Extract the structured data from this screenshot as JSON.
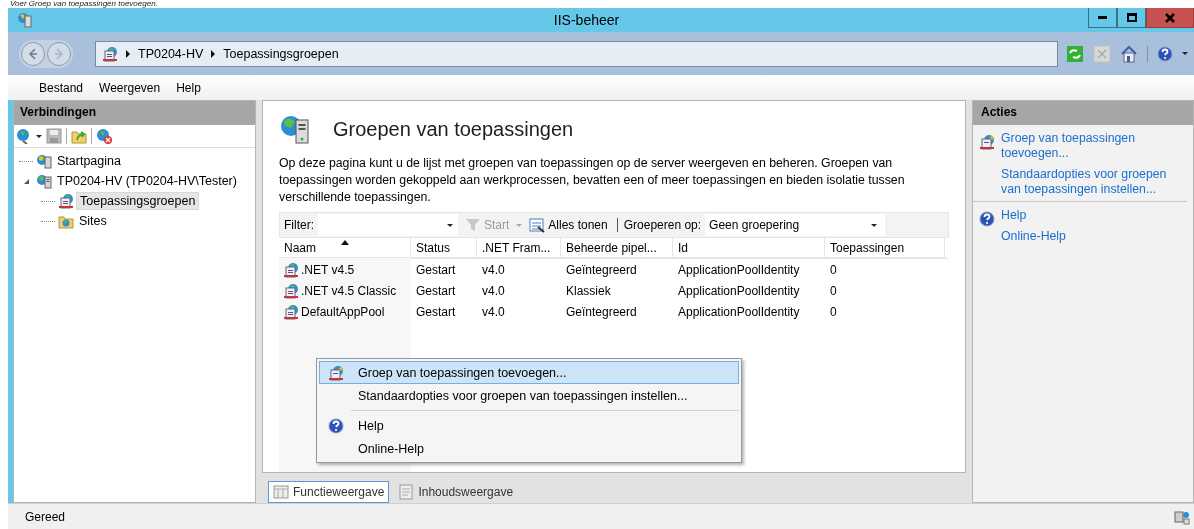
{
  "caption": "Voer Groep van toepassingen toevoegen.",
  "window": {
    "title": "IIS-beheer"
  },
  "address": {
    "crumbs": [
      "TP0204-HV",
      "Toepassingsgroepen"
    ]
  },
  "menu": [
    "Bestand",
    "Weergeven",
    "Help"
  ],
  "connections": {
    "title": "Verbindingen",
    "tree": [
      {
        "label": "Startpagina",
        "kind": "start",
        "selected": false
      },
      {
        "label": "TP0204-HV (TP0204-HV\\Tester)",
        "kind": "server",
        "selected": false,
        "expanded": true,
        "children": [
          {
            "label": "Toepassingsgroepen",
            "kind": "pools",
            "selected": true
          },
          {
            "label": "Sites",
            "kind": "sites",
            "selected": false
          }
        ]
      }
    ]
  },
  "page": {
    "title": "Groepen van toepassingen",
    "description": "Op deze pagina kunt u de lijst met groepen van toepassingen op de server weergeven en beheren. Groepen van toepassingen worden gekoppeld aan werkprocessen, bevatten een of meer toepassingen en bieden isolatie tussen verschillende toepassingen.",
    "filter_label": "Filter:",
    "start": {
      "label": "Start",
      "disabled": true
    },
    "show_all": "Alles tonen",
    "group_label": "Groeperen op:",
    "group_value": "Geen groepering"
  },
  "table": {
    "columns": [
      {
        "label": "Naam",
        "sorted": true
      },
      {
        "label": "Status",
        "sorted": false
      },
      {
        "label": ".NET Fram...",
        "sorted": false
      },
      {
        "label": "Beheerde pipel...",
        "sorted": false
      },
      {
        "label": "Id",
        "sorted": false
      },
      {
        "label": "Toepassingen",
        "sorted": false
      }
    ],
    "rows": [
      [
        ".NET v4.5",
        "Gestart",
        "v4.0",
        "Geïntegreerd",
        "ApplicationPoolIdentity",
        "0"
      ],
      [
        ".NET v4.5 Classic",
        "Gestart",
        "v4.0",
        "Klassiek",
        "ApplicationPoolIdentity",
        "0"
      ],
      [
        "DefaultAppPool",
        "Gestart",
        "v4.0",
        "Geïntegreerd",
        "ApplicationPoolIdentity",
        "0"
      ]
    ]
  },
  "view_tabs": [
    {
      "label": "Functieweergave",
      "selected": true
    },
    {
      "label": "Inhoudsweergave",
      "selected": false
    }
  ],
  "actions": {
    "title": "Acties",
    "groups": [
      {
        "kind": "add",
        "links": [
          "Groep van toepassingen toevoegen...",
          "Standaardopties voor groepen van toepassingen instellen..."
        ]
      },
      {
        "kind": "help",
        "links": [
          "Help",
          "Online-Help"
        ]
      }
    ]
  },
  "context_menu": [
    {
      "kind": "add",
      "label": "Groep van toepassingen toevoegen...",
      "selected": true
    },
    {
      "kind": "plain",
      "label": "Standaardopties voor groepen van toepassingen instellen...",
      "selected": false
    },
    {
      "kind": "separator"
    },
    {
      "kind": "help",
      "label": "Help",
      "selected": false
    },
    {
      "kind": "plain",
      "label": "Online-Help",
      "selected": false
    }
  ],
  "status": "Gereed"
}
